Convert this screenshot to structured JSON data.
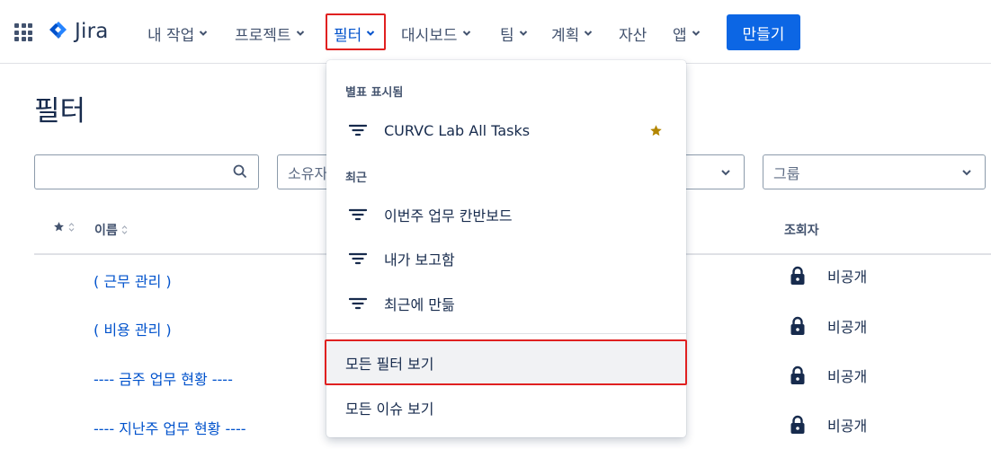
{
  "nav": {
    "app_name": "Jira",
    "items": [
      {
        "label": "내 작업"
      },
      {
        "label": "프로젝트"
      },
      {
        "label": "필터"
      },
      {
        "label": "대시보드"
      },
      {
        "label": "팀"
      },
      {
        "label": "계획"
      },
      {
        "label": "자산"
      },
      {
        "label": "앱"
      }
    ],
    "create_label": "만들기"
  },
  "page": {
    "title": "필터",
    "search": {
      "value": "",
      "placeholder": ""
    },
    "owner_placeholder": "소유자",
    "group_placeholder": "그룹",
    "columns": {
      "name": "이름",
      "viewer": "조회자"
    },
    "rows": [
      {
        "name": "( 근무 관리 )",
        "viewer": "비공개"
      },
      {
        "name": "( 비용 관리 )",
        "viewer": "비공개"
      },
      {
        "name": "---- 금주 업무 현황 ----",
        "viewer": "비공개"
      },
      {
        "name": "---- 지난주 업무 현황 ----",
        "viewer": "비공개"
      }
    ]
  },
  "dropdown": {
    "starred_heading": "별표 표시됨",
    "starred": [
      {
        "label": "CURVC Lab All Tasks"
      }
    ],
    "recent_heading": "최근",
    "recent": [
      {
        "label": "이번주 업무 칸반보드"
      },
      {
        "label": "내가 보고함"
      },
      {
        "label": "최근에 만듦"
      }
    ],
    "view_all_filters": "모든 필터 보기",
    "view_all_issues": "모든 이슈 보기"
  },
  "icons": {
    "apps": "apps-grid-icon",
    "logo": "jira-logo-icon",
    "chevron": "chevron-down-icon",
    "search": "search-icon",
    "filter": "filter-lines-icon",
    "star": "star-icon",
    "lock": "lock-icon",
    "sort": "sort-icon"
  },
  "colors": {
    "brand_blue": "#0c66e4",
    "link_blue": "#0052cc",
    "star_gold": "#b38600",
    "highlight_red": "#e02020"
  }
}
